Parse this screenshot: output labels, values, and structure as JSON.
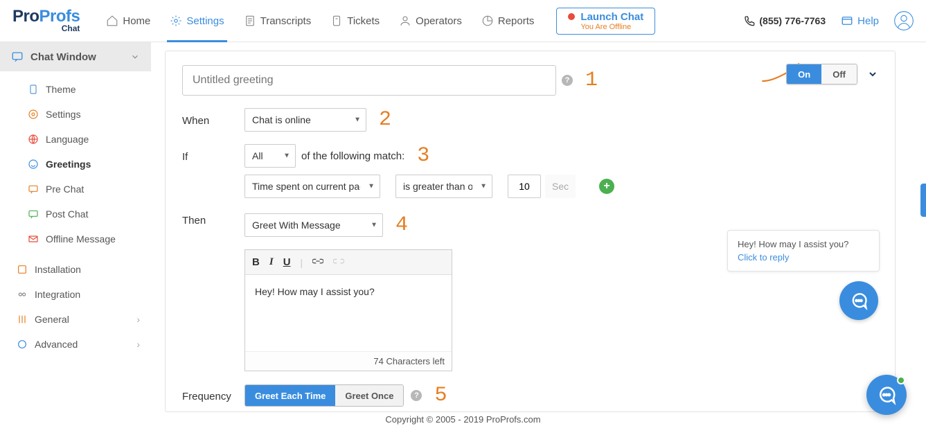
{
  "brand": {
    "pro": "Pro",
    "profs": "Profs",
    "chat": "Chat"
  },
  "nav": {
    "home": "Home",
    "settings": "Settings",
    "transcripts": "Transcripts",
    "tickets": "Tickets",
    "operators": "Operators",
    "reports": "Reports"
  },
  "launch": {
    "title": "Launch Chat",
    "sub": "You Are Offline"
  },
  "header": {
    "phone": "(855) 776-7763",
    "help": "Help"
  },
  "sidebar": {
    "header": "Chat Window",
    "items": [
      {
        "label": "Theme"
      },
      {
        "label": "Settings"
      },
      {
        "label": "Language"
      },
      {
        "label": "Greetings"
      },
      {
        "label": "Pre Chat"
      },
      {
        "label": "Post Chat"
      },
      {
        "label": "Offline Message"
      }
    ],
    "roots": [
      {
        "label": "Installation"
      },
      {
        "label": "Integration"
      },
      {
        "label": "General"
      },
      {
        "label": "Advanced"
      }
    ]
  },
  "form": {
    "greeting_placeholder": "Untitled greeting",
    "toggle_on": "On",
    "toggle_off": "Off",
    "when_label": "When",
    "when_value": "Chat is online",
    "if_label": "If",
    "if_mode": "All",
    "if_tail": "of the following match:",
    "cond_field": "Time spent on current page",
    "cond_op": "is greater than or equal",
    "cond_value": "10",
    "cond_unit": "Sec",
    "then_label": "Then",
    "then_value": "Greet With Message",
    "editor_body": "Hey! How may I assist you?",
    "editor_count": "74 Characters left",
    "freq_label": "Frequency",
    "freq_each": "Greet Each Time",
    "freq_once": "Greet Once"
  },
  "annotations": {
    "n1": "1",
    "n2": "2",
    "n3": "3",
    "n4": "4",
    "n5": "5"
  },
  "preview": {
    "msg": "Hey! How may I assist you?",
    "reply": "Click to reply"
  },
  "footer": "Copyright © 2005 - 2019 ProProfs.com"
}
